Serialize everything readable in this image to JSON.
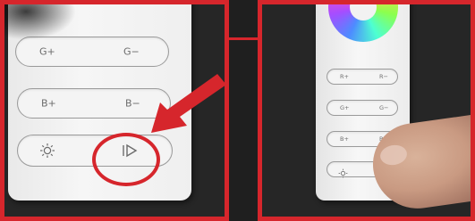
{
  "colors": {
    "highlight": "#d6262c",
    "background": "#262626",
    "remote": "#f1f1f1"
  },
  "left_panel": {
    "buttons": [
      {
        "label_left": "G+",
        "label_right": "G−"
      },
      {
        "label_left": "B+",
        "label_right": "B−"
      },
      {
        "icon_left": "sun-brightness-icon",
        "icon_right": "play-mode-icon"
      }
    ]
  },
  "right_panel": {
    "buttons": [
      {
        "label_left": "R+",
        "label_right": "R−"
      },
      {
        "label_left": "G+",
        "label_right": "G−"
      },
      {
        "label_left": "B+",
        "label_right": "B−"
      },
      {
        "icon_left": "sun-brightness-icon"
      }
    ]
  }
}
